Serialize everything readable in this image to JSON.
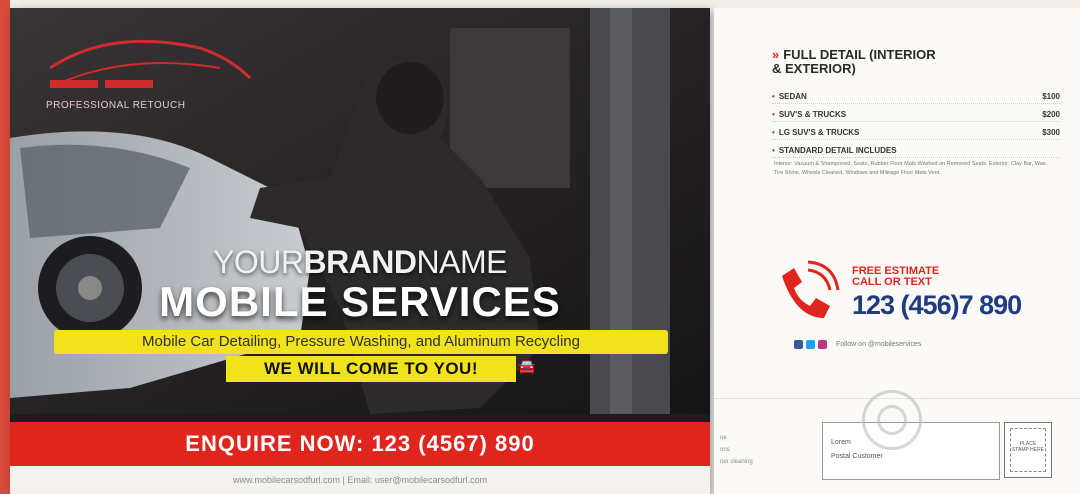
{
  "front": {
    "logo_tagline": "PROFESSIONAL RETOUCH",
    "brand_light1": "YOUR",
    "brand_bold": "BRAND",
    "brand_light2": "NAME",
    "headline": "MOBILE SERVICES",
    "services": "Mobile Car Detailing, Pressure Washing, and Aluminum Recycling",
    "come_to_you": "WE WILL COME TO YOU!",
    "enquire": "ENQUIRE NOW: 123 (4567) 890",
    "footer": "www.mobilecarsodfurl.com  |  Email: user@mobilecarsodfurl.com"
  },
  "back": {
    "title_line1": "FULL DETAIL (INTERIOR",
    "title_line2": "& EXTERIOR)",
    "items": [
      {
        "name": "SEDAN",
        "price": "$100"
      },
      {
        "name": "SUV'S & TRUCKS",
        "price": "$200"
      },
      {
        "name": "LG SUV'S & TRUCKS",
        "price": "$300"
      },
      {
        "name": "STANDARD DETAIL INCLUDES",
        "price": ""
      }
    ],
    "description": "Interior: Vacuum & Shampooed, Seats, Rubber Floor Mats Washed on Removed Seats. Exterior: Clay Bar, Wax. Tire Shine, Wheels Cleaned, Windows and Mileage Floor Mats Vent.",
    "free_estimate_1": "FREE ESTIMATE",
    "free_estimate_2": "CALL OR TEXT",
    "phone": "123 (456)7 890",
    "social_text": "Follow on @mobileservices",
    "addr_line1": "Lorem",
    "addr_line2": "Postal Customer",
    "stamp_text": "PLACE STAMP HERE",
    "leftover_1": "ne",
    "leftover_2": "ons",
    "leftover_3": "ner cleaning"
  },
  "colors": {
    "accent_red": "#e0251f",
    "yellow": "#f2e21b",
    "phone_blue": "#1f3b82"
  }
}
